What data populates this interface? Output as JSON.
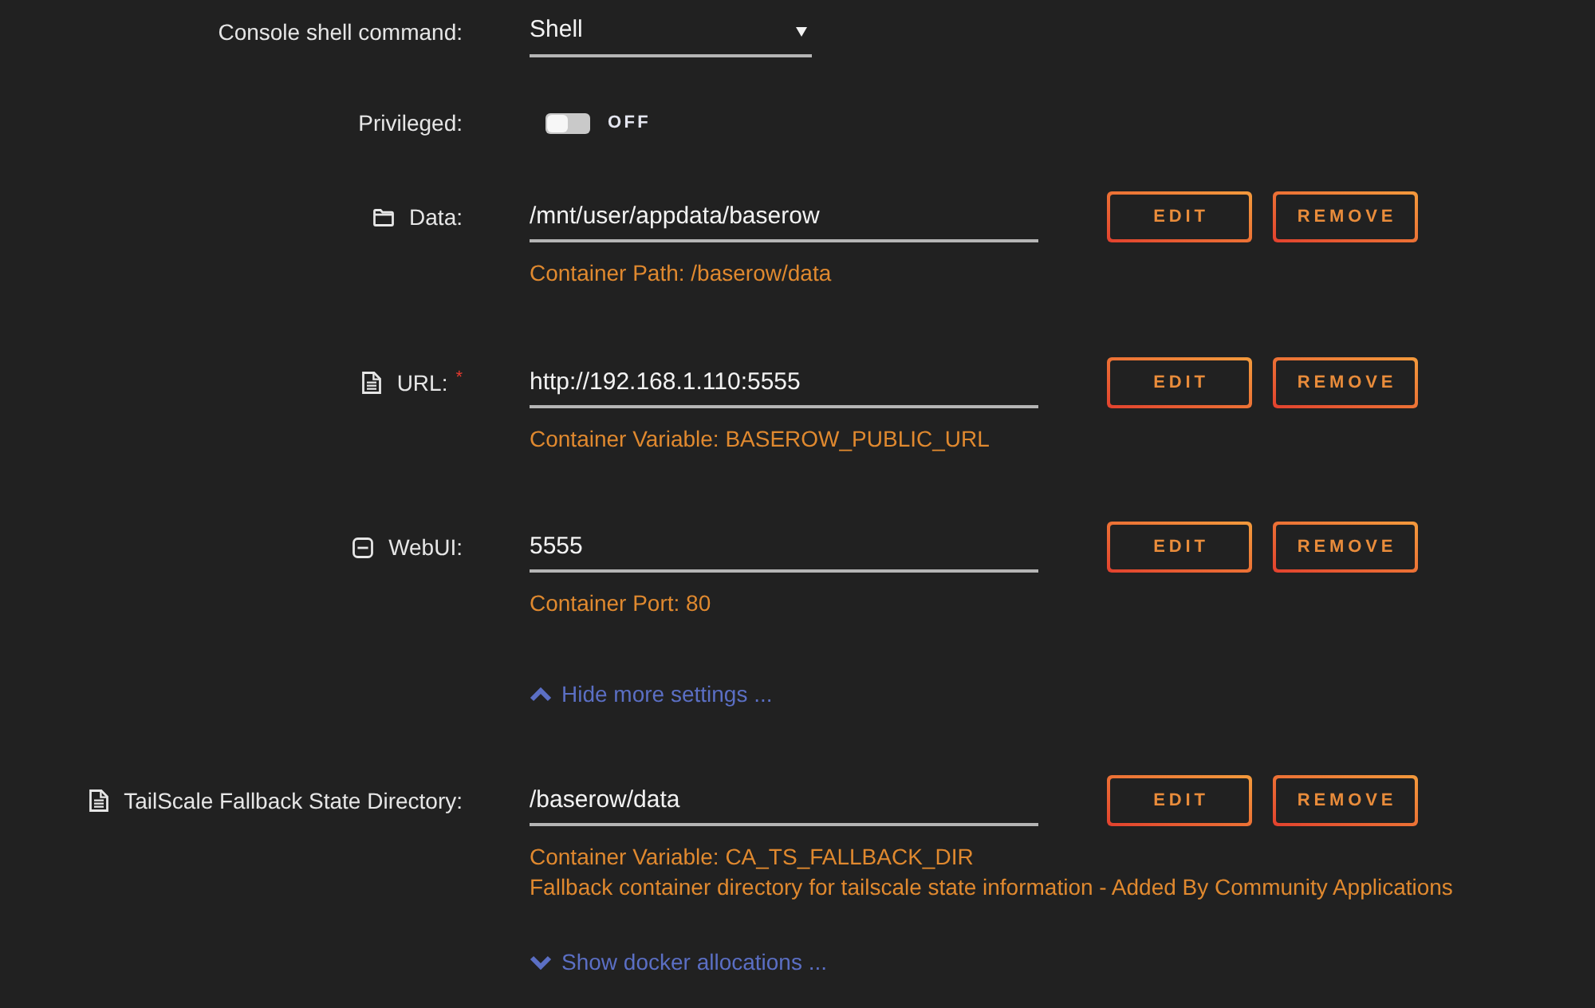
{
  "rows": [
    {
      "kind": "select",
      "label": "Console shell command:",
      "value": "Shell"
    },
    {
      "kind": "switch",
      "label": "Privileged:",
      "on": false,
      "state_text": "OFF"
    },
    {
      "kind": "path",
      "label": "Data:",
      "value": "/mnt/user/appdata/baserow",
      "notes": [
        "Container Path: /baserow/data"
      ],
      "buttons": [
        "EDIT",
        "REMOVE"
      ]
    },
    {
      "kind": "variable",
      "label": "URL:",
      "required_mark": "*",
      "value": "http://192.168.1.110:5555",
      "notes": [
        "Container Variable: BASEROW_PUBLIC_URL"
      ],
      "buttons": [
        "EDIT",
        "REMOVE"
      ]
    },
    {
      "kind": "port",
      "label": "WebUI:",
      "value": "5555",
      "notes": [
        "Container Port: 80"
      ],
      "buttons": [
        "EDIT",
        "REMOVE"
      ]
    },
    {
      "kind": "more_link",
      "label": "Hide more settings ...",
      "expanded": true
    },
    {
      "kind": "variable",
      "label": "TailScale Fallback State Directory:",
      "value": "/baserow/data",
      "notes": [
        "Container Variable: CA_TS_FALLBACK_DIR",
        "Fallback container directory for tailscale state information - Added By Community Applications"
      ],
      "buttons": [
        "EDIT",
        "REMOVE"
      ]
    },
    {
      "kind": "more_link",
      "label": "Show docker allocations ...",
      "expanded": false
    }
  ]
}
